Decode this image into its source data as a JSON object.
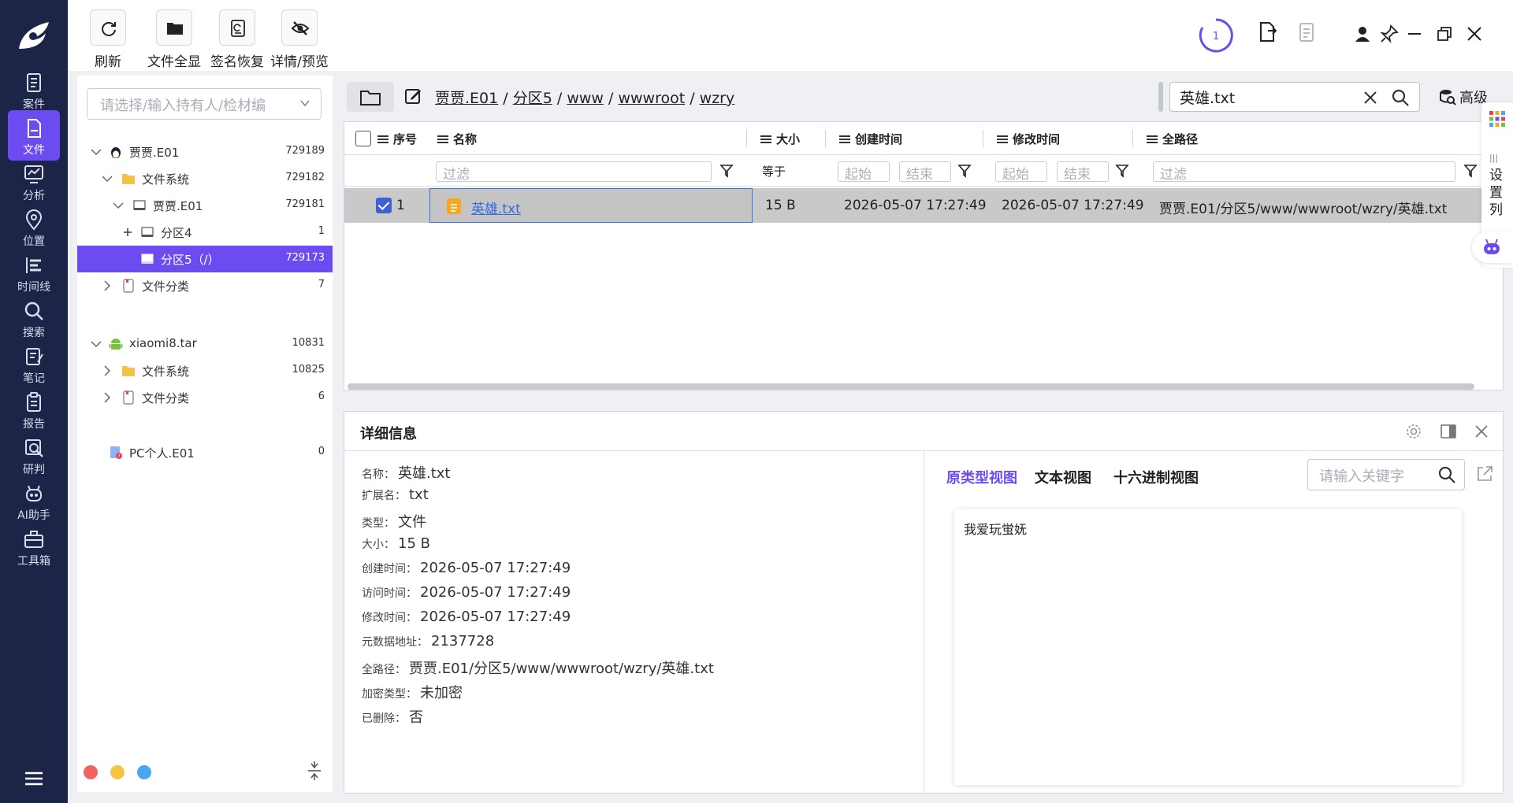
{
  "toolbar": {
    "buttons": [
      {
        "label": "刷新",
        "icon": "refresh-icon"
      },
      {
        "label": "文件全显",
        "icon": "folder-icon"
      },
      {
        "label": "签名恢复",
        "icon": "signature-restore-icon"
      },
      {
        "label": "详情/预览",
        "icon": "eye-slash-icon"
      }
    ],
    "task_count": "1"
  },
  "nav": {
    "items": [
      {
        "label": "案件",
        "icon": "case-icon"
      },
      {
        "label": "文件",
        "icon": "file-icon",
        "active": true
      },
      {
        "label": "分析",
        "icon": "analysis-icon"
      },
      {
        "label": "位置",
        "icon": "location-icon"
      },
      {
        "label": "时间线",
        "icon": "timeline-icon"
      },
      {
        "label": "搜索",
        "icon": "search-icon"
      },
      {
        "label": "笔记",
        "icon": "notes-icon"
      },
      {
        "label": "报告",
        "icon": "report-icon"
      },
      {
        "label": "研判",
        "icon": "judge-icon"
      },
      {
        "label": "AI助手",
        "icon": "robot-icon"
      },
      {
        "label": "工具箱",
        "icon": "toolbox-icon"
      }
    ]
  },
  "tree": {
    "placeholder": "请选择/输入持有人/检材编",
    "rows": [
      {
        "label": "贾贾.E01",
        "count": "729189",
        "icon": "linux-icon",
        "expanded": true
      },
      {
        "label": "文件系统",
        "count": "729182",
        "icon": "folder-icon",
        "expanded": true
      },
      {
        "label": "贾贾.E01",
        "count": "729181",
        "icon": "disk-icon",
        "expanded": true
      },
      {
        "label": "分区4",
        "count": "1",
        "icon": "disk-icon"
      },
      {
        "label": "分区5（/）",
        "count": "729173",
        "icon": "disk-icon",
        "selected": true
      },
      {
        "label": "文件分类",
        "count": "7",
        "icon": "category-icon"
      },
      {
        "label": "xiaomi8.tar",
        "count": "10831",
        "icon": "android-icon",
        "expanded": true
      },
      {
        "label": "文件系统",
        "count": "10825",
        "icon": "folder-icon"
      },
      {
        "label": "文件分类",
        "count": "6",
        "icon": "category-icon"
      },
      {
        "label": "PC个人.E01",
        "count": "0",
        "icon": "pc-icon"
      }
    ],
    "dot_colors": [
      "#f26363",
      "#f6c445",
      "#4aa6f0"
    ]
  },
  "breadcrumb": {
    "segments": [
      "贾贾.E01",
      "分区5",
      "www",
      "wwwroot",
      "wzry"
    ],
    "sep": "/"
  },
  "search": {
    "value": "英雄.txt"
  },
  "advanced_label": "高级",
  "grid": {
    "columns": [
      "序号",
      "名称",
      "大小",
      "创建时间",
      "修改时间",
      "全路径"
    ],
    "filters": {
      "filter": "过滤",
      "equals": "等于",
      "start": "起始",
      "end": "结束"
    },
    "rows": [
      {
        "index": "1",
        "name": "英雄.txt",
        "size": "15 B",
        "created": "2026-05-07 17:27:49",
        "modified": "2026-05-07 17:27:49",
        "path": "贾贾.E01/分区5/www/wwwroot/wzry/英雄.txt",
        "checked": true
      }
    ]
  },
  "side_tools": {
    "column_settings": "设置列"
  },
  "detail": {
    "title": "详细信息",
    "props": [
      {
        "k": "名称：",
        "v": "英雄.txt"
      },
      {
        "k": "扩展名：",
        "v": "txt"
      },
      {
        "k": "类型：",
        "v": "文件"
      },
      {
        "k": "大小：",
        "v": "15 B"
      },
      {
        "k": "创建时间：",
        "v": "2026-05-07 17:27:49"
      },
      {
        "k": "访问时间：",
        "v": "2026-05-07 17:27:49"
      },
      {
        "k": "修改时间：",
        "v": "2026-05-07 17:27:49"
      },
      {
        "k": "元数据地址：",
        "v": "2137728"
      },
      {
        "k": "全路径：",
        "v": "贾贾.E01/分区5/www/wwwroot/wzry/英雄.txt"
      },
      {
        "k": "加密类型：",
        "v": "未加密"
      },
      {
        "k": "已删除：",
        "v": "否"
      }
    ],
    "tabs": [
      "原类型视图",
      "文本视图",
      "十六进制视图"
    ],
    "keyword_placeholder": "请输入关键字",
    "content": "我爱玩蛍妩"
  },
  "colors": {
    "nav_bg": "#1c2548",
    "accent": "#6c4cf1",
    "link": "#2f6ae8"
  }
}
